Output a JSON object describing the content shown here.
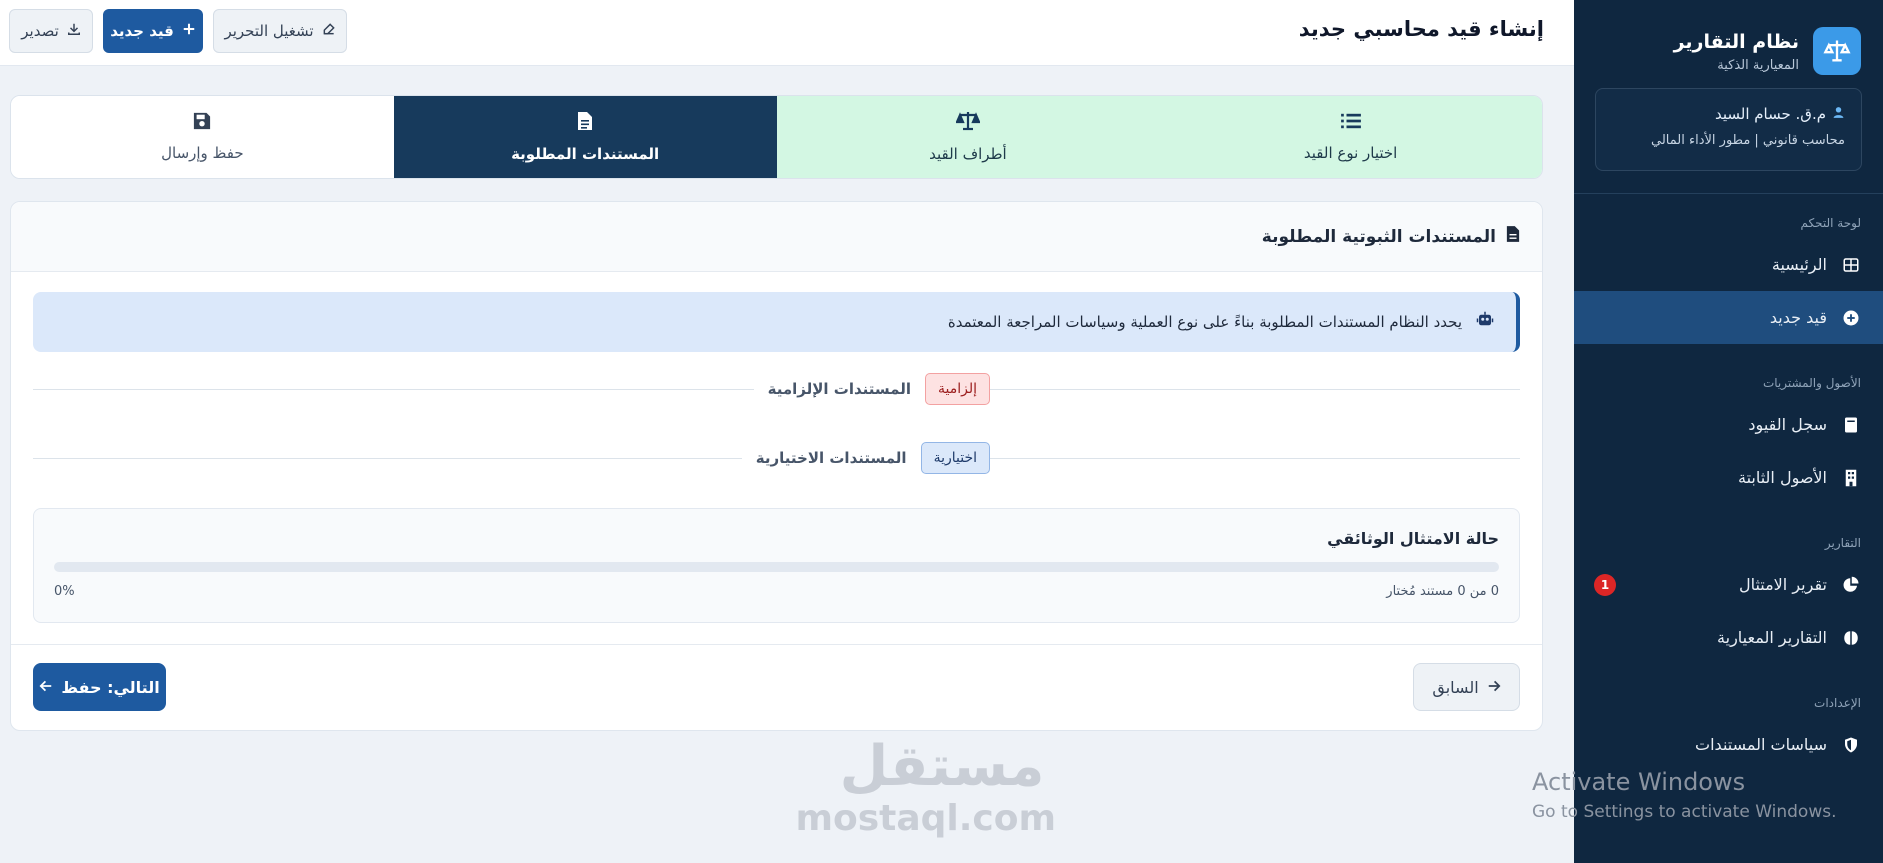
{
  "brand": {
    "title": "نظام التقارير",
    "subtitle": "المعيارية الذكية"
  },
  "user": {
    "name": "م.ق. حسام السيد",
    "role": "محاسب قانوني | مطور الأداء المالي"
  },
  "sidebar": {
    "sections": [
      {
        "label": "لوحة التحكم",
        "items": [
          {
            "label": "الرئيسية",
            "icon": "grid-icon"
          },
          {
            "label": "قيد جديد",
            "icon": "plus-circle-icon",
            "active": true
          }
        ]
      },
      {
        "label": "الأصول والمشتريات",
        "items": [
          {
            "label": "سجل القيود",
            "icon": "book-icon"
          },
          {
            "label": "الأصول الثابتة",
            "icon": "building-icon"
          }
        ]
      },
      {
        "label": "التقارير",
        "items": [
          {
            "label": "تقرير الامتثال",
            "icon": "pie-chart-icon",
            "badge": "1"
          },
          {
            "label": "التقارير المعيارية",
            "icon": "brain-icon"
          }
        ]
      },
      {
        "label": "الإعدادات",
        "items": [
          {
            "label": "سياسات المستندات",
            "icon": "shield-icon"
          }
        ]
      }
    ]
  },
  "header": {
    "title": "إنشاء قيد محاسبي جديد",
    "buttons": {
      "run_edit": "تشغيل التحرير",
      "new_entry": "قيد جديد",
      "export": "تصدير"
    }
  },
  "stepper": [
    {
      "label": "اختيار نوع القيد",
      "icon": "list-icon",
      "state": "done"
    },
    {
      "label": "أطراف القيد",
      "icon": "scale-icon",
      "state": "done"
    },
    {
      "label": "المستندات المطلوبة",
      "icon": "document-icon",
      "state": "current"
    },
    {
      "label": "حفظ وإرسال",
      "icon": "save-icon",
      "state": "pending"
    }
  ],
  "card": {
    "title": "المستندات الثبوتية المطلوبة",
    "info": "يحدد النظام المستندات المطلوبة بناءً على نوع العملية وسياسات المراجعة المعتمدة",
    "required": {
      "label": "المستندات الإلزامية",
      "tag": "إلزامية"
    },
    "optional": {
      "label": "المستندات الاختيارية",
      "tag": "اختيارية"
    },
    "compliance": {
      "title": "حالة الامتثال الوثائقي",
      "progress": 0,
      "percent_text": "0%",
      "count_text": "0 من 0 مستند مُختار"
    },
    "prev": "السابق",
    "next": "التالي: حفظ"
  },
  "watermark": {
    "ar": "مستقل",
    "en": "mostaql.com"
  },
  "activation": {
    "title": "Activate Windows",
    "subtitle": "Go to Settings to activate Windows."
  },
  "colors": {
    "sidebar": "#0f2740",
    "primary": "#1e5aa0",
    "step_done": "#d3f7e3",
    "step_current": "#173a5c",
    "badge": "#dc2626"
  }
}
